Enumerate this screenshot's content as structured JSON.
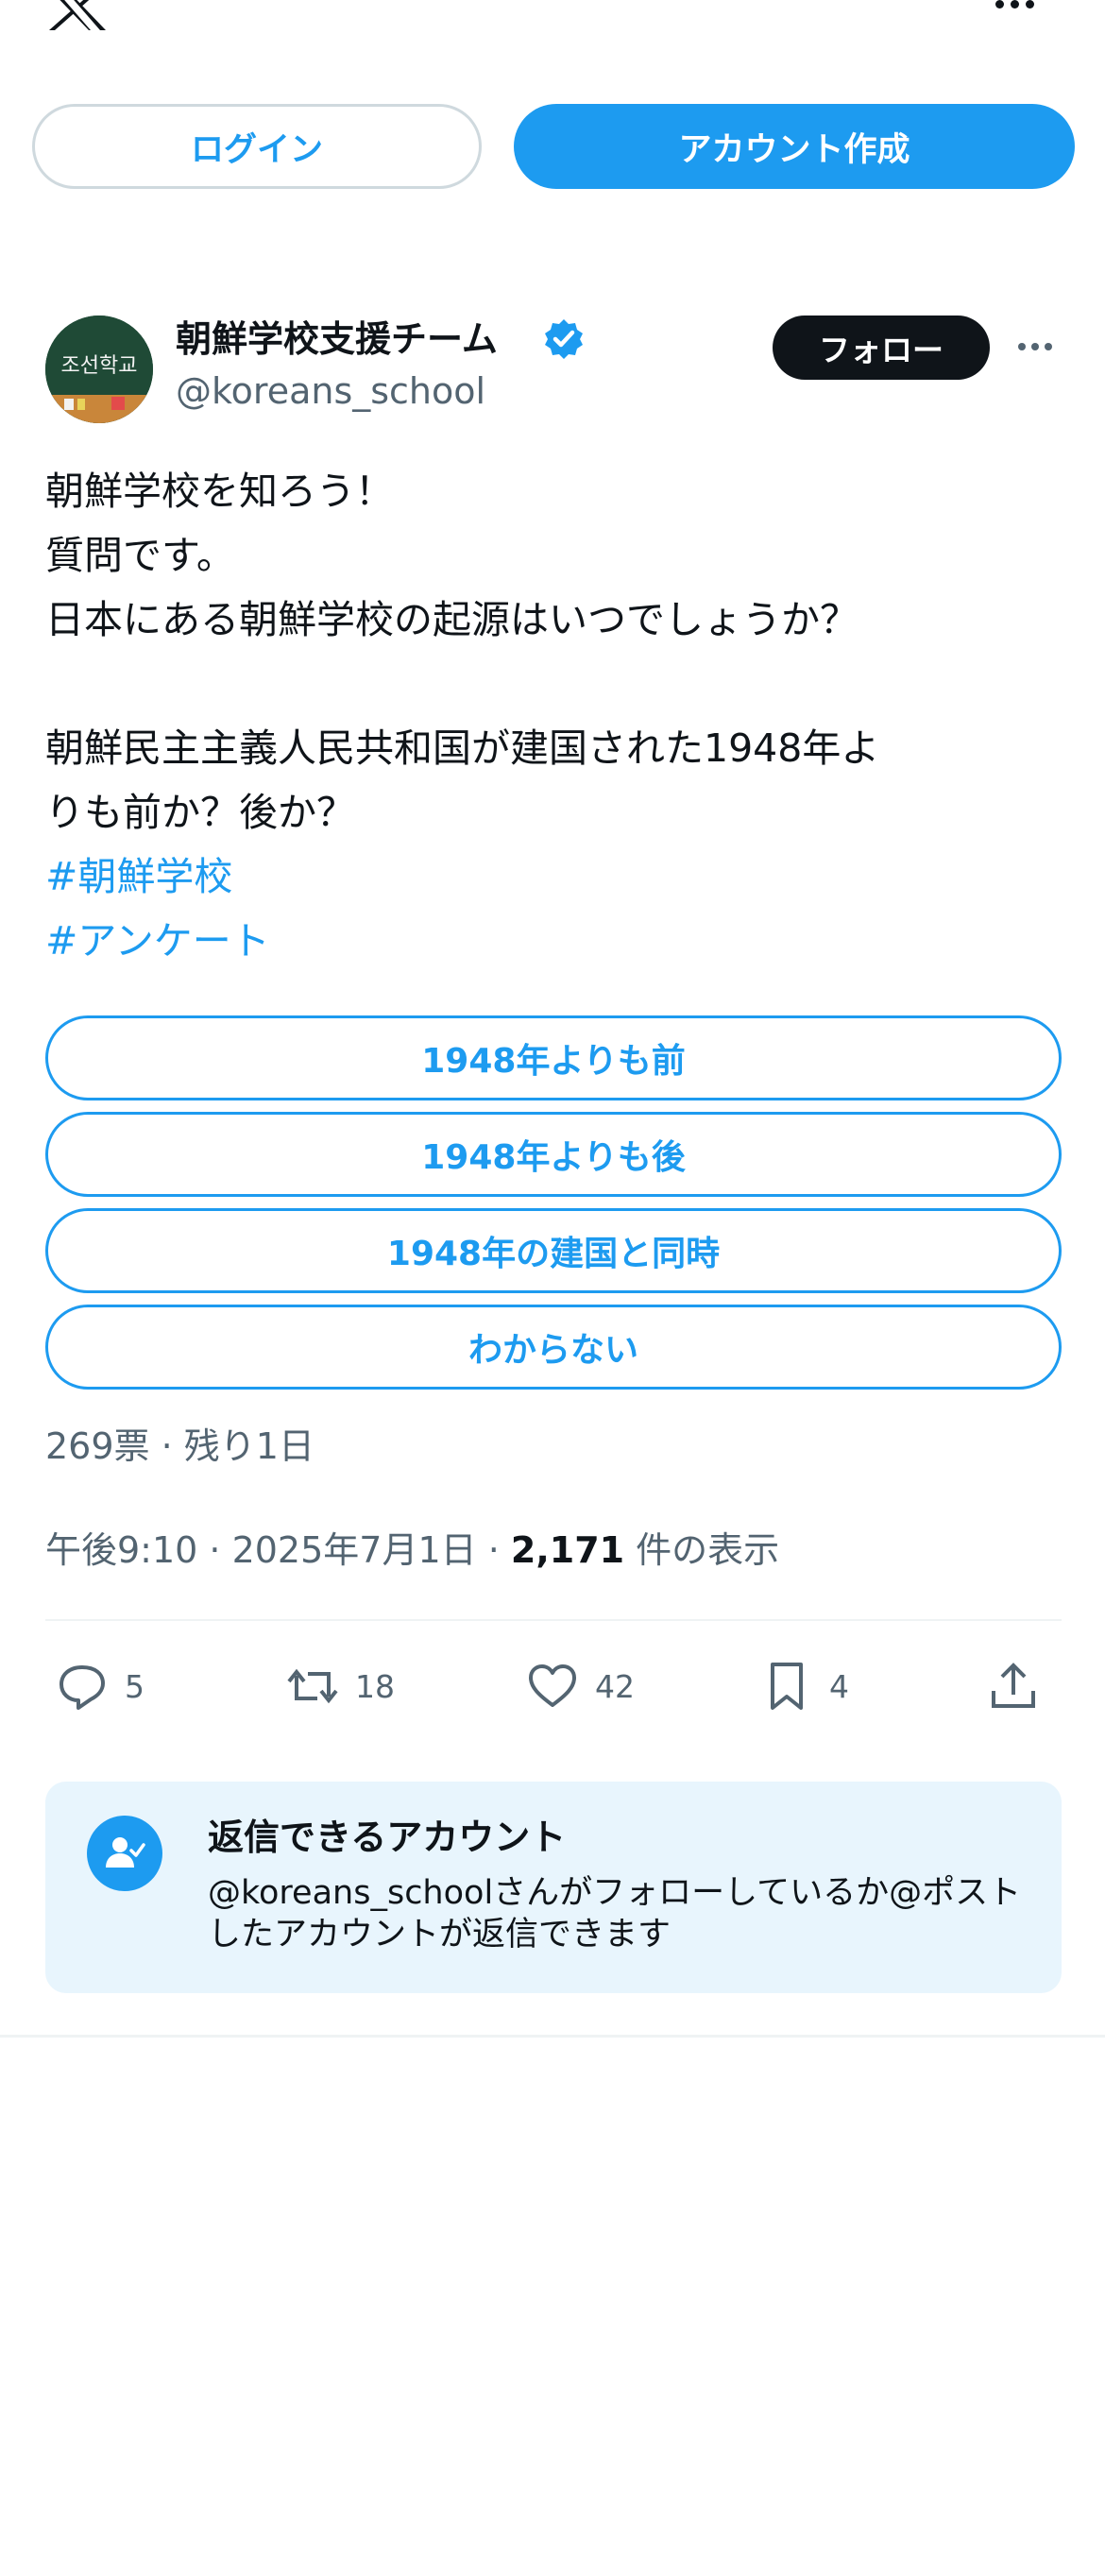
{
  "top_bar": {
    "logo_icon": "x-logo-icon",
    "more_icon": "more-horizontal-icon"
  },
  "auth": {
    "login_label": "ログイン",
    "signup_label": "アカウント作成"
  },
  "post": {
    "author": {
      "name": "朝鮮学校支援チーム",
      "handle": "@koreans_school",
      "verified": true,
      "avatar_text": "조선학교"
    },
    "follow_label": "フォロー",
    "text_lines": [
      "朝鮮学校を知ろう！",
      "質問です。",
      "日本にある朝鮮学校の起源はいつでしょうか？",
      "",
      "朝鮮民主主義人民共和国が建国された1948年よ",
      "りも前か？後か？"
    ],
    "hashtags": [
      "#朝鮮学校",
      "#アンケート"
    ],
    "poll": {
      "options": [
        "1948年よりも前",
        "1948年よりも後",
        "1948年の建国と同時",
        "わからない"
      ],
      "summary": "269票 · 残り1日"
    },
    "meta": {
      "time_date": "午後9:10 · 2025年7月1日 · ",
      "views_count": "2,171",
      "views_label": " 件の表示"
    },
    "actions": {
      "replies": "5",
      "reposts": "18",
      "likes": "42",
      "bookmarks": "4"
    }
  },
  "reply_restriction": {
    "title": "返信できるアカウント",
    "description": "@koreans_schoolさんがフォローしているか@ポストしたアカウントが返信できます"
  },
  "colors": {
    "accent": "#1d9bf0",
    "text": "#0f1419",
    "secondary": "#536471",
    "info_bg": "#e8f5fd"
  }
}
